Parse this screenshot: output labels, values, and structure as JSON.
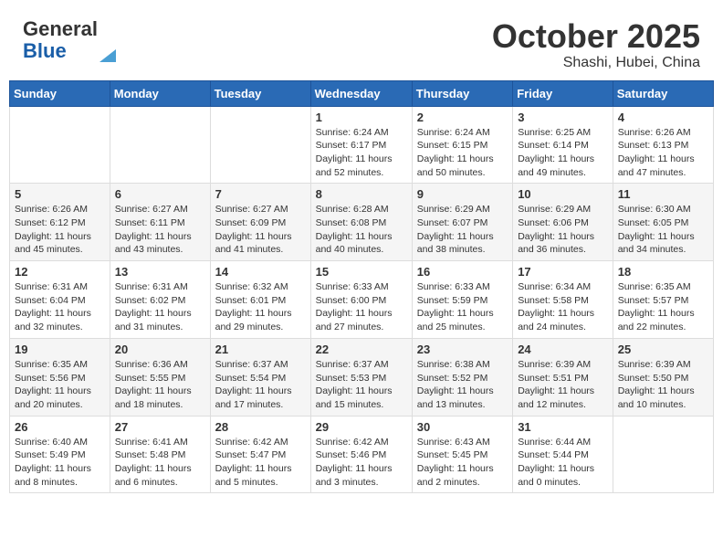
{
  "header": {
    "logo_general": "General",
    "logo_blue": "Blue",
    "month": "October 2025",
    "location": "Shashi, Hubei, China"
  },
  "days_of_week": [
    "Sunday",
    "Monday",
    "Tuesday",
    "Wednesday",
    "Thursday",
    "Friday",
    "Saturday"
  ],
  "weeks": [
    [
      {
        "day": "",
        "sunrise": "",
        "sunset": "",
        "daylight": ""
      },
      {
        "day": "",
        "sunrise": "",
        "sunset": "",
        "daylight": ""
      },
      {
        "day": "",
        "sunrise": "",
        "sunset": "",
        "daylight": ""
      },
      {
        "day": "1",
        "sunrise": "Sunrise: 6:24 AM",
        "sunset": "Sunset: 6:17 PM",
        "daylight": "Daylight: 11 hours and 52 minutes."
      },
      {
        "day": "2",
        "sunrise": "Sunrise: 6:24 AM",
        "sunset": "Sunset: 6:15 PM",
        "daylight": "Daylight: 11 hours and 50 minutes."
      },
      {
        "day": "3",
        "sunrise": "Sunrise: 6:25 AM",
        "sunset": "Sunset: 6:14 PM",
        "daylight": "Daylight: 11 hours and 49 minutes."
      },
      {
        "day": "4",
        "sunrise": "Sunrise: 6:26 AM",
        "sunset": "Sunset: 6:13 PM",
        "daylight": "Daylight: 11 hours and 47 minutes."
      }
    ],
    [
      {
        "day": "5",
        "sunrise": "Sunrise: 6:26 AM",
        "sunset": "Sunset: 6:12 PM",
        "daylight": "Daylight: 11 hours and 45 minutes."
      },
      {
        "day": "6",
        "sunrise": "Sunrise: 6:27 AM",
        "sunset": "Sunset: 6:11 PM",
        "daylight": "Daylight: 11 hours and 43 minutes."
      },
      {
        "day": "7",
        "sunrise": "Sunrise: 6:27 AM",
        "sunset": "Sunset: 6:09 PM",
        "daylight": "Daylight: 11 hours and 41 minutes."
      },
      {
        "day": "8",
        "sunrise": "Sunrise: 6:28 AM",
        "sunset": "Sunset: 6:08 PM",
        "daylight": "Daylight: 11 hours and 40 minutes."
      },
      {
        "day": "9",
        "sunrise": "Sunrise: 6:29 AM",
        "sunset": "Sunset: 6:07 PM",
        "daylight": "Daylight: 11 hours and 38 minutes."
      },
      {
        "day": "10",
        "sunrise": "Sunrise: 6:29 AM",
        "sunset": "Sunset: 6:06 PM",
        "daylight": "Daylight: 11 hours and 36 minutes."
      },
      {
        "day": "11",
        "sunrise": "Sunrise: 6:30 AM",
        "sunset": "Sunset: 6:05 PM",
        "daylight": "Daylight: 11 hours and 34 minutes."
      }
    ],
    [
      {
        "day": "12",
        "sunrise": "Sunrise: 6:31 AM",
        "sunset": "Sunset: 6:04 PM",
        "daylight": "Daylight: 11 hours and 32 minutes."
      },
      {
        "day": "13",
        "sunrise": "Sunrise: 6:31 AM",
        "sunset": "Sunset: 6:02 PM",
        "daylight": "Daylight: 11 hours and 31 minutes."
      },
      {
        "day": "14",
        "sunrise": "Sunrise: 6:32 AM",
        "sunset": "Sunset: 6:01 PM",
        "daylight": "Daylight: 11 hours and 29 minutes."
      },
      {
        "day": "15",
        "sunrise": "Sunrise: 6:33 AM",
        "sunset": "Sunset: 6:00 PM",
        "daylight": "Daylight: 11 hours and 27 minutes."
      },
      {
        "day": "16",
        "sunrise": "Sunrise: 6:33 AM",
        "sunset": "Sunset: 5:59 PM",
        "daylight": "Daylight: 11 hours and 25 minutes."
      },
      {
        "day": "17",
        "sunrise": "Sunrise: 6:34 AM",
        "sunset": "Sunset: 5:58 PM",
        "daylight": "Daylight: 11 hours and 24 minutes."
      },
      {
        "day": "18",
        "sunrise": "Sunrise: 6:35 AM",
        "sunset": "Sunset: 5:57 PM",
        "daylight": "Daylight: 11 hours and 22 minutes."
      }
    ],
    [
      {
        "day": "19",
        "sunrise": "Sunrise: 6:35 AM",
        "sunset": "Sunset: 5:56 PM",
        "daylight": "Daylight: 11 hours and 20 minutes."
      },
      {
        "day": "20",
        "sunrise": "Sunrise: 6:36 AM",
        "sunset": "Sunset: 5:55 PM",
        "daylight": "Daylight: 11 hours and 18 minutes."
      },
      {
        "day": "21",
        "sunrise": "Sunrise: 6:37 AM",
        "sunset": "Sunset: 5:54 PM",
        "daylight": "Daylight: 11 hours and 17 minutes."
      },
      {
        "day": "22",
        "sunrise": "Sunrise: 6:37 AM",
        "sunset": "Sunset: 5:53 PM",
        "daylight": "Daylight: 11 hours and 15 minutes."
      },
      {
        "day": "23",
        "sunrise": "Sunrise: 6:38 AM",
        "sunset": "Sunset: 5:52 PM",
        "daylight": "Daylight: 11 hours and 13 minutes."
      },
      {
        "day": "24",
        "sunrise": "Sunrise: 6:39 AM",
        "sunset": "Sunset: 5:51 PM",
        "daylight": "Daylight: 11 hours and 12 minutes."
      },
      {
        "day": "25",
        "sunrise": "Sunrise: 6:39 AM",
        "sunset": "Sunset: 5:50 PM",
        "daylight": "Daylight: 11 hours and 10 minutes."
      }
    ],
    [
      {
        "day": "26",
        "sunrise": "Sunrise: 6:40 AM",
        "sunset": "Sunset: 5:49 PM",
        "daylight": "Daylight: 11 hours and 8 minutes."
      },
      {
        "day": "27",
        "sunrise": "Sunrise: 6:41 AM",
        "sunset": "Sunset: 5:48 PM",
        "daylight": "Daylight: 11 hours and 6 minutes."
      },
      {
        "day": "28",
        "sunrise": "Sunrise: 6:42 AM",
        "sunset": "Sunset: 5:47 PM",
        "daylight": "Daylight: 11 hours and 5 minutes."
      },
      {
        "day": "29",
        "sunrise": "Sunrise: 6:42 AM",
        "sunset": "Sunset: 5:46 PM",
        "daylight": "Daylight: 11 hours and 3 minutes."
      },
      {
        "day": "30",
        "sunrise": "Sunrise: 6:43 AM",
        "sunset": "Sunset: 5:45 PM",
        "daylight": "Daylight: 11 hours and 2 minutes."
      },
      {
        "day": "31",
        "sunrise": "Sunrise: 6:44 AM",
        "sunset": "Sunset: 5:44 PM",
        "daylight": "Daylight: 11 hours and 0 minutes."
      },
      {
        "day": "",
        "sunrise": "",
        "sunset": "",
        "daylight": ""
      }
    ]
  ]
}
